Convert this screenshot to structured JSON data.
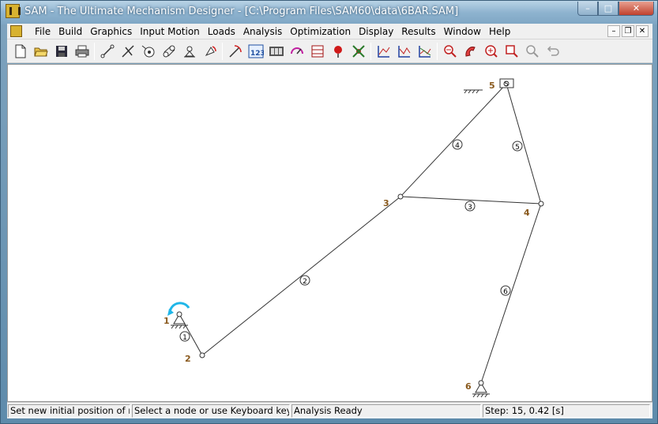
{
  "window": {
    "title": "SAM - The Ultimate Mechanism Designer - [C:\\Program Files\\SAM60\\data\\6BAR.SAM]",
    "min_label": "–",
    "max_label": "□",
    "close_label": "✕"
  },
  "menu": {
    "items": [
      "File",
      "Build",
      "Graphics",
      "Input Motion",
      "Loads",
      "Analysis",
      "Optimization",
      "Display",
      "Results",
      "Window",
      "Help"
    ],
    "mdi_min": "–",
    "mdi_restore": "❐",
    "mdi_close": "✕"
  },
  "toolbar": {
    "icons": [
      "new-file-icon",
      "open-folder-icon",
      "save-disk-icon",
      "print-icon",
      "beam-element-icon",
      "slider-element-icon",
      "gear-element-icon",
      "belt-element-icon",
      "fixed-support-icon",
      "input-motion-icon",
      "analysis-run-icon",
      "results-table-icon",
      "animation-icon",
      "optimization-icon",
      "loads-icon",
      "force-icon",
      "graph-icon",
      "properties-icon",
      "chart-xy-icon",
      "chart-xy2-icon",
      "chart-xy3-icon",
      "zoom-out-icon",
      "zoom-in-icon",
      "zoom-fit-icon",
      "zoom-window-icon",
      "zoom-previous-icon",
      "undo-icon"
    ]
  },
  "mechanism": {
    "nodes": [
      {
        "id": "1",
        "label": "1"
      },
      {
        "id": "2",
        "label": "2"
      },
      {
        "id": "3",
        "label": "3"
      },
      {
        "id": "4",
        "label": "4"
      },
      {
        "id": "5",
        "label": "5"
      },
      {
        "id": "6",
        "label": "6"
      }
    ],
    "elements": [
      {
        "id": "1",
        "label": "1"
      },
      {
        "id": "2",
        "label": "2"
      },
      {
        "id": "3",
        "label": "3"
      },
      {
        "id": "4",
        "label": "4"
      },
      {
        "id": "5",
        "label": "5"
      },
      {
        "id": "6",
        "label": "6"
      }
    ],
    "colors": {
      "node_label": "#8a5a1e",
      "input_arrow": "#1fb6e8",
      "link": "#333333"
    }
  },
  "status": {
    "pane1": "Set new initial position of m",
    "pane2": "Select a node or use Keyboard keys",
    "pane3": "Analysis Ready",
    "pane4": "Step: 15,     0.42 [s]"
  }
}
